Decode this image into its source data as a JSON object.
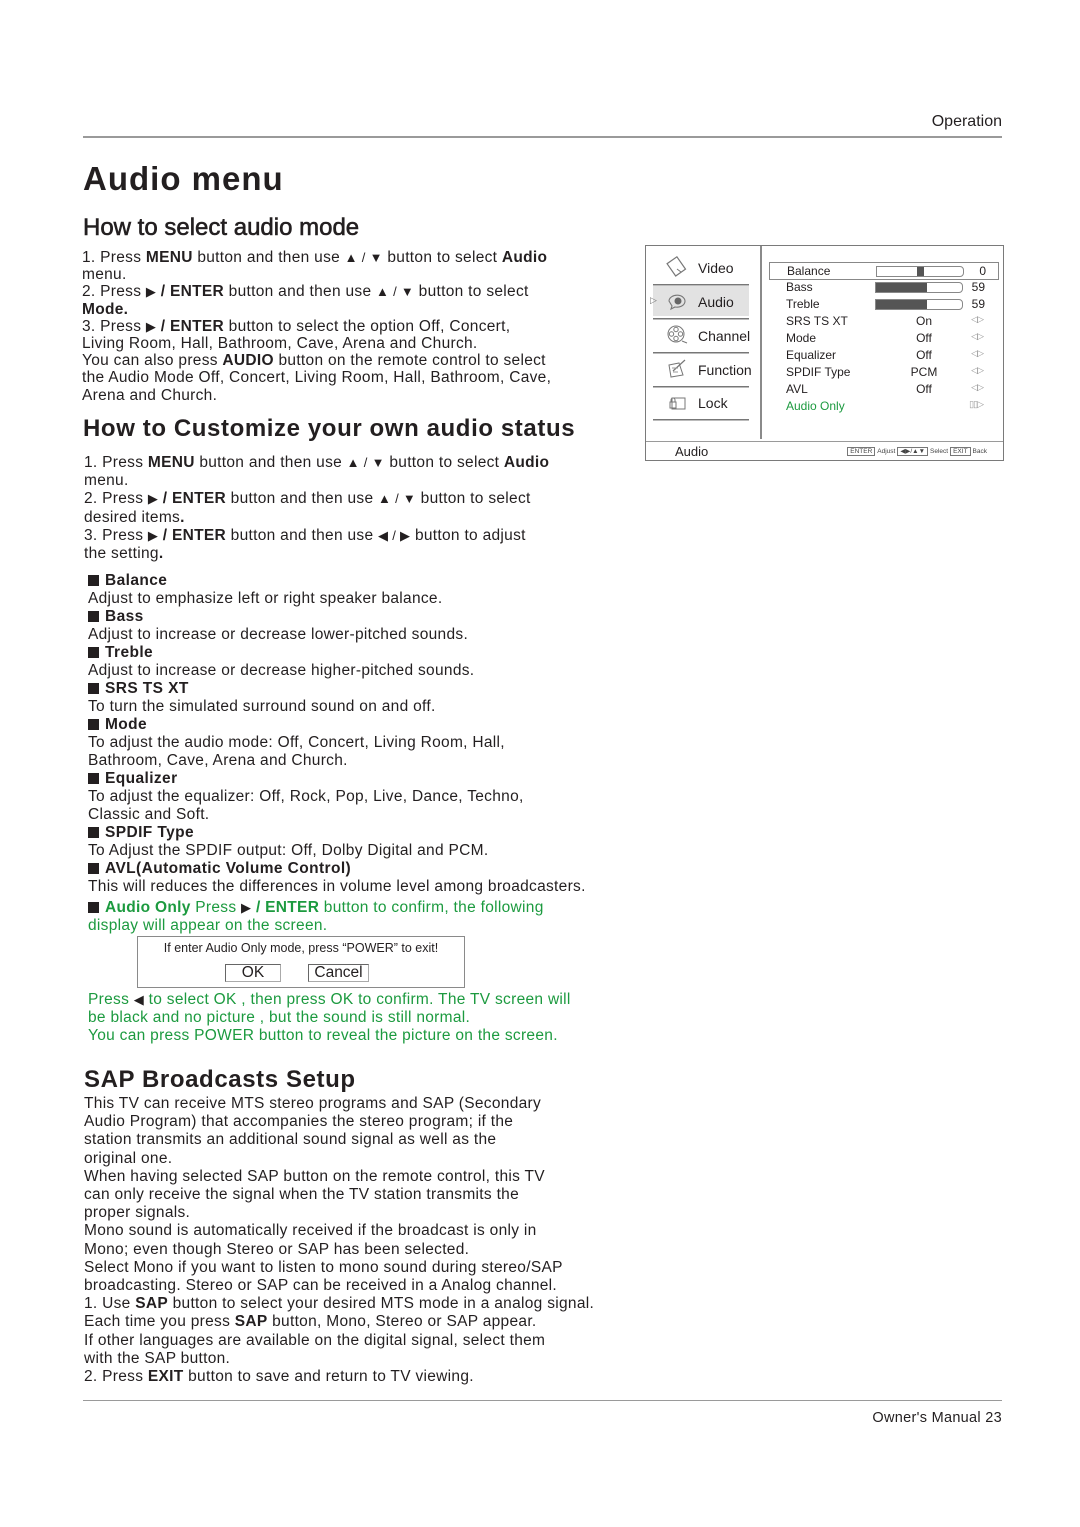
{
  "header": {
    "section_label": "Operation"
  },
  "page_title": "Audio menu",
  "select_mode": {
    "heading": "How to select audio mode",
    "lines": [
      [
        "1. Press ",
        {
          "b": "MENU"
        },
        " button and then use ",
        {
          "t": "▲ / ▼"
        },
        " button to select ",
        {
          "b": "Audio"
        }
      ],
      [
        "menu."
      ],
      [
        "2. Press ",
        {
          "t": "▶"
        },
        {
          "b": " / ENTER"
        },
        " button and then use ",
        {
          "t": "▲ / ▼"
        },
        " button to select"
      ],
      [
        {
          "b": "Mode."
        }
      ],
      [
        "3. Press ",
        {
          "t": "▶"
        },
        {
          "b": " / ENTER"
        },
        " button to select the option Off, Concert,"
      ],
      [
        "Living Room, Hall, Bathroom, Cave, Arena and Church."
      ],
      [
        "You can also press ",
        {
          "b": "AUDIO"
        },
        " button on the remote control to select"
      ],
      [
        "the Audio Mode Off, Concert, Living Room, Hall, Bathroom, Cave,"
      ],
      [
        "Arena and Church."
      ]
    ]
  },
  "customize": {
    "heading": "How to Customize your own audio status",
    "lines": [
      [
        "1. Press ",
        {
          "b": "MENU"
        },
        " button and then use ",
        {
          "t": "▲ / ▼"
        },
        " button to select ",
        {
          "b": "Audio"
        }
      ],
      [
        "menu."
      ],
      [
        "2. Press ",
        {
          "t": "▶"
        },
        {
          "b": " / ENTER"
        },
        " button and then use ",
        {
          "t": "▲ / ▼"
        },
        " button to select"
      ],
      [
        "desired items",
        {
          "b": "."
        }
      ],
      [
        "3. Press ",
        {
          "t": "▶"
        },
        {
          "b": " / ENTER"
        },
        " button and then use ",
        {
          "t": "◀ / ▶"
        },
        " button to adjust"
      ],
      [
        "the setting",
        {
          "b": "."
        }
      ]
    ],
    "items": [
      {
        "title": "Balance",
        "desc": [
          "Adjust to emphasize left or right speaker balance."
        ]
      },
      {
        "title": "Bass",
        "desc": [
          "Adjust to increase or decrease lower-pitched sounds."
        ]
      },
      {
        "title": "Treble",
        "desc": [
          "Adjust to increase or decrease higher-pitched sounds."
        ]
      },
      {
        "title": "SRS TS XT",
        "desc": [
          "To turn the simulated surround sound on and off."
        ]
      },
      {
        "title": "Mode",
        "desc": [
          "To adjust  the audio mode: Off, Concert, Living Room, Hall,",
          "Bathroom, Cave, Arena and Church."
        ]
      },
      {
        "title": "Equalizer",
        "desc": [
          "To adjust  the equalizer: Off, Rock, Pop, Live, Dance, Techno,",
          "Classic and Soft."
        ]
      },
      {
        "title": "SPDIF Type",
        "desc": [
          "To Adjust the SPDIF output: Off, Dolby Digital and  PCM."
        ]
      },
      {
        "title": "AVL(Automatic Volume Control)",
        "desc": [
          "This will reduces the differences in volume level among broadcasters."
        ]
      }
    ],
    "audio_only": {
      "title": "Audio Only",
      "intro_pre": " Press  ",
      "intro_key": "▶",
      "intro_bold": "/ ENTER",
      "intro_post": " button to confirm, the following",
      "intro_line2": "display will appear on the screen.",
      "after_lines": [
        [
          "Press ",
          {
            "t": "◀"
          },
          " to select OK , then press OK to confirm. The TV screen will"
        ],
        [
          "be black and no picture , but the sound is still normal."
        ],
        [
          "You can press POWER button to reveal the picture on the screen."
        ]
      ],
      "color": "#1c9a3f"
    }
  },
  "dialog": {
    "message": "If enter Audio Only mode, press “POWER” to exit!",
    "ok_label": "OK",
    "cancel_label": "Cancel"
  },
  "sap": {
    "heading": "SAP Broadcasts Setup",
    "lines": [
      [
        "This TV can receive MTS stereo programs and SAP (Secondary"
      ],
      [
        "Audio Program) that accompanies the stereo program; if the"
      ],
      [
        "station transmits an additional sound signal as well as the"
      ],
      [
        "original one."
      ],
      [
        "When having selected SAP button on the remote control, this TV"
      ],
      [
        "can only receive the signal when the TV station transmits the"
      ],
      [
        "proper signals."
      ],
      [
        "Mono sound is automatically received if the broadcast is only in"
      ],
      [
        "Mono; even though Stereo or SAP has been selected."
      ],
      [
        "Select Mono if you want to listen to mono sound during stereo/SAP"
      ],
      [
        "broadcasting. Stereo or SAP can be received in a Analog channel."
      ],
      [
        "1. Use ",
        {
          "b": "SAP"
        },
        " button to select your desired MTS mode in a analog signal."
      ],
      [
        "Each time you press ",
        {
          "b": "SAP"
        },
        " button, Mono, Stereo or SAP appear."
      ],
      [
        "If other languages are available on the digital signal, select them"
      ],
      [
        "with the SAP button."
      ],
      [
        "2. Press ",
        {
          "b": "EXIT"
        },
        " button to save and return to TV viewing."
      ]
    ]
  },
  "osd": {
    "nav": [
      {
        "label": "Video",
        "icon": "video-icon",
        "active": false
      },
      {
        "label": "Audio",
        "icon": "audio-icon",
        "active": true
      },
      {
        "label": "Channel",
        "icon": "channel-icon",
        "active": false
      },
      {
        "label": "Function",
        "icon": "function-icon",
        "active": false
      },
      {
        "label": "Lock",
        "icon": "lock-icon",
        "active": false
      }
    ],
    "rows": [
      {
        "name": "Balance",
        "type": "balance",
        "value": "0",
        "position_fraction": 0.5
      },
      {
        "name": "Bass",
        "type": "slider",
        "value": "59",
        "fill_fraction": 0.59
      },
      {
        "name": "Treble",
        "type": "slider",
        "value": "59",
        "fill_fraction": 0.59
      },
      {
        "name": "SRS TS XT",
        "type": "option",
        "value": "On"
      },
      {
        "name": "Mode",
        "type": "option",
        "value": "Off"
      },
      {
        "name": "Equalizer",
        "type": "option",
        "value": "Off"
      },
      {
        "name": "SPDIF Type",
        "type": "option",
        "value": "PCM"
      },
      {
        "name": "AVL",
        "type": "option",
        "value": "Off"
      },
      {
        "name": "Audio Only",
        "type": "enter",
        "value": ""
      }
    ],
    "selected_row": "Balance",
    "footer_title": "Audio",
    "footer_hint": {
      "enter_key": "ENTER",
      "adjust_label": "Adjust",
      "nav_keys": "◀▶/▲▼",
      "select_label": "Select",
      "exit_key": "EXIT",
      "back_label": "Back"
    },
    "accent_color": "#1c9a3f"
  },
  "footer": {
    "label": "Owner's Manual 23"
  }
}
